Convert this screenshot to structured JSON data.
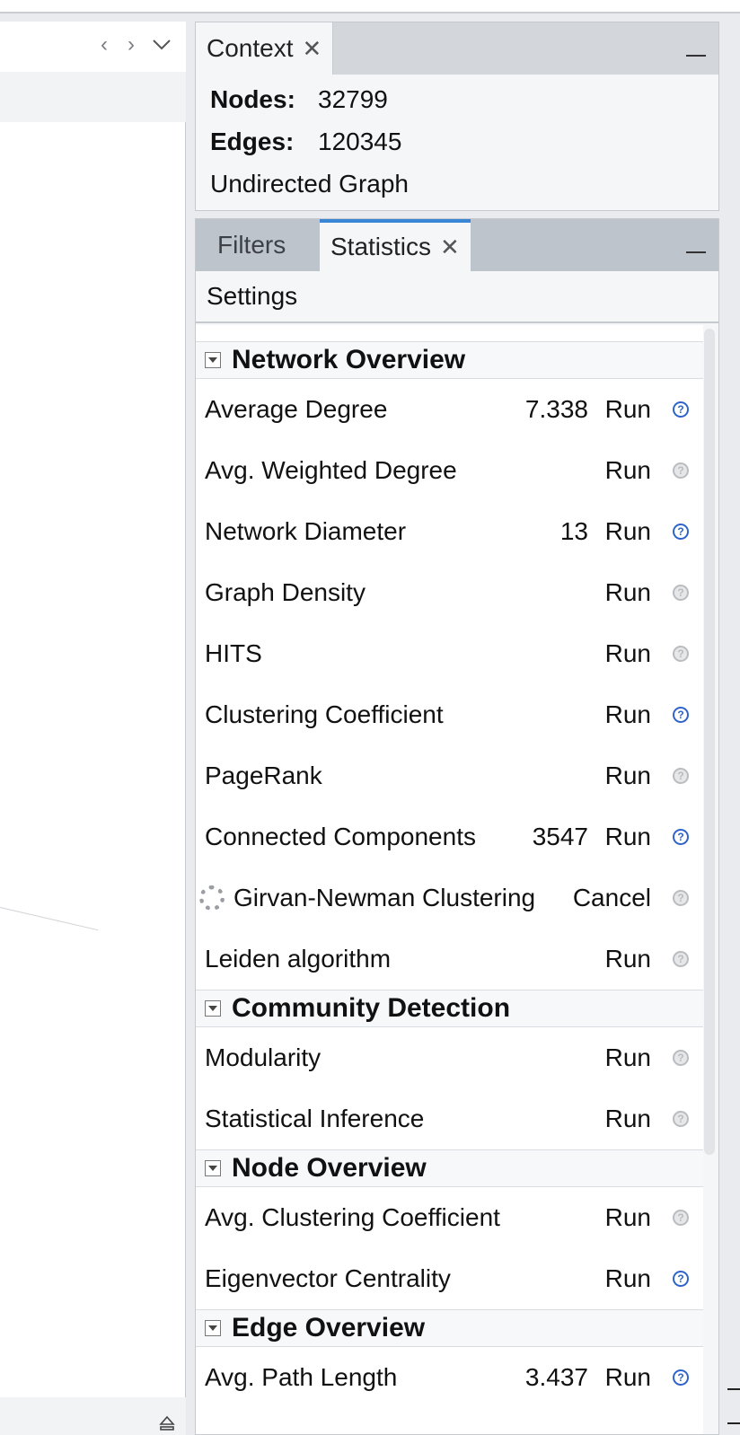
{
  "context": {
    "tab_label": "Context",
    "nodes_label": "Nodes:",
    "nodes_value": "32799",
    "edges_label": "Edges:",
    "edges_value": "120345",
    "graph_type": "Undirected Graph"
  },
  "stats_panel": {
    "tab_filters": "Filters",
    "tab_statistics": "Statistics",
    "settings_label": "Settings",
    "sections": [
      {
        "title": "Network Overview",
        "rows": [
          {
            "name": "Average Degree",
            "value": "7.338",
            "action": "Run",
            "help": "blue"
          },
          {
            "name": "Avg. Weighted Degree",
            "value": "",
            "action": "Run",
            "help": "gray"
          },
          {
            "name": "Network Diameter",
            "value": "13",
            "action": "Run",
            "help": "blue"
          },
          {
            "name": "Graph Density",
            "value": "",
            "action": "Run",
            "help": "gray"
          },
          {
            "name": "HITS",
            "value": "",
            "action": "Run",
            "help": "gray"
          },
          {
            "name": "Clustering Coefficient",
            "value": "",
            "action": "Run",
            "help": "blue"
          },
          {
            "name": "PageRank",
            "value": "",
            "action": "Run",
            "help": "gray"
          },
          {
            "name": "Connected Components",
            "value": "3547",
            "action": "Run",
            "help": "blue"
          },
          {
            "name": "Girvan-Newman Clustering",
            "value": "",
            "action": "Cancel",
            "help": "gray",
            "running": true
          },
          {
            "name": "Leiden algorithm",
            "value": "",
            "action": "Run",
            "help": "gray"
          }
        ]
      },
      {
        "title": "Community Detection",
        "rows": [
          {
            "name": "Modularity",
            "value": "",
            "action": "Run",
            "help": "gray"
          },
          {
            "name": "Statistical Inference",
            "value": "",
            "action": "Run",
            "help": "gray"
          }
        ]
      },
      {
        "title": "Node Overview",
        "rows": [
          {
            "name": "Avg. Clustering Coefficient",
            "value": "",
            "action": "Run",
            "help": "gray"
          },
          {
            "name": "Eigenvector Centrality",
            "value": "",
            "action": "Run",
            "help": "blue"
          }
        ]
      },
      {
        "title": "Edge Overview",
        "rows": [
          {
            "name": "Avg. Path Length",
            "value": "3.437",
            "action": "Run",
            "help": "blue"
          }
        ]
      }
    ]
  },
  "icons": {
    "nav_back": "chevron-left-icon",
    "nav_forward": "chevron-right-icon",
    "nav_menu": "chevron-down-icon",
    "close": "close-icon",
    "minimize": "minimize-icon",
    "collapse": "collapse-icon",
    "help": "help-icon",
    "spinner": "spinner-icon",
    "eject": "eject-icon"
  },
  "colors": {
    "accent_tab": "#3a86d6",
    "help_active": "#2f63c9",
    "help_inactive": "#b9bcc0"
  }
}
